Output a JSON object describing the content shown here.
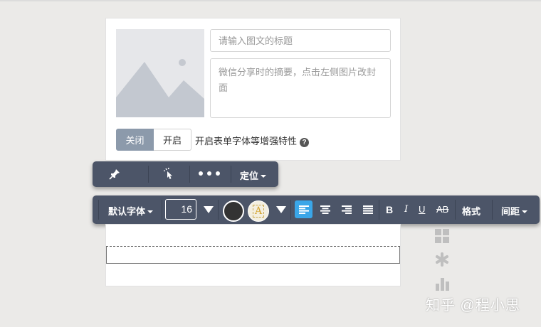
{
  "card": {
    "title_placeholder": "请输入图文的标题",
    "summary_placeholder": "微信分享时的摘要，点击左侧图片改封面",
    "toggle_off_label": "关闭",
    "toggle_on_label": "开启",
    "toggle_description": "开启表单字体等增强特性"
  },
  "toolbar_primary": {
    "position_label": "定位"
  },
  "toolbar_format": {
    "font_family": "默认字体",
    "font_size": "16",
    "format_label": "格式",
    "spacing_label": "间距",
    "bold_label": "B",
    "italic_label": "I",
    "underline_label": "U",
    "strike_label": "AB",
    "text_color": "#333333",
    "background_glyph": "A"
  },
  "watermark": "知乎 @程小思",
  "colors": {
    "toolbar_bg": "#4c5568",
    "active_align": "#3aa6e8",
    "toggle_off_bg": "#8c9aab"
  }
}
